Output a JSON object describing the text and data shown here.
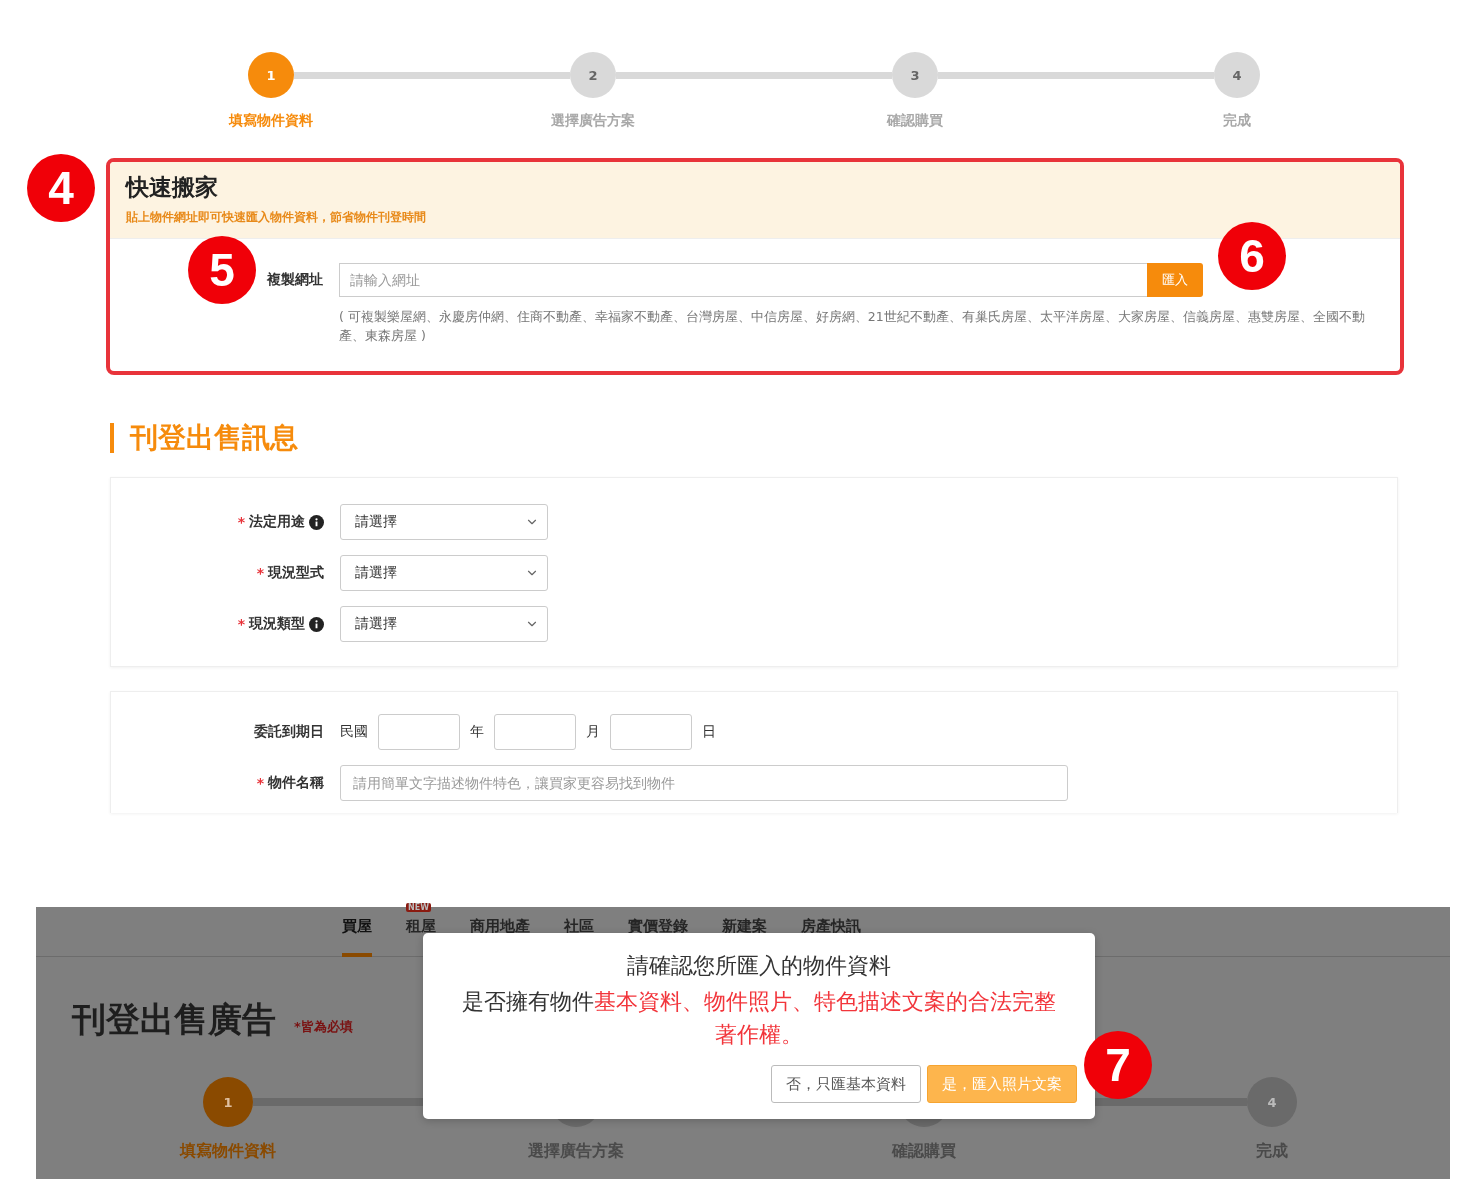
{
  "steps": [
    {
      "number": "1",
      "label": "填寫物件資料",
      "selected": true
    },
    {
      "number": "2",
      "label": "選擇廣告方案",
      "selected": false
    },
    {
      "number": "3",
      "label": "確認購買",
      "selected": false
    },
    {
      "number": "4",
      "label": "完成",
      "selected": false
    }
  ],
  "callouts": [
    "4",
    "5",
    "6",
    "7"
  ],
  "required_mark": "*",
  "quick_import": {
    "title": "快速搬家",
    "subtitle": "貼上物件網址即可快速匯入物件資料，節省物件刊登時間",
    "url_label": "複製網址",
    "url_placeholder": "請輸入網址",
    "import_button": "匯入",
    "supported_sites": "( 可複製樂屋網、永慶房仲網、住商不動產、幸福家不動產、台灣房屋、中信房屋、好房網、21世紀不動產、有巢氏房屋、太平洋房屋、大家房屋、信義房屋、惠雙房屋、全國不動產、東森房屋 )"
  },
  "section_title": "刊登出售訊息",
  "selects": [
    {
      "label": "法定用途",
      "required": true,
      "info": true,
      "value": "請選擇"
    },
    {
      "label": "現況型式",
      "required": true,
      "info": false,
      "value": "請選擇"
    },
    {
      "label": "現況類型",
      "required": true,
      "info": true,
      "value": "請選擇"
    }
  ],
  "expiry": {
    "label": "委託到期日",
    "era": "民國",
    "units": [
      "年",
      "月",
      "日"
    ]
  },
  "title_field": {
    "label": "物件名稱",
    "required": true,
    "placeholder": "請用簡單文字描述物件特色，讓買家更容易找到物件"
  },
  "popup_screen": {
    "nav": [
      {
        "label": "買屋",
        "selected": true
      },
      {
        "label": "租屋",
        "selected": false,
        "badge": "NEW"
      },
      {
        "label": "商用地產",
        "selected": false
      },
      {
        "label": "社區",
        "selected": false
      },
      {
        "label": "實價登錄",
        "selected": false
      },
      {
        "label": "新建案",
        "selected": false
      },
      {
        "label": "房產快訊",
        "selected": false
      }
    ],
    "page_title": "刊登出售廣告",
    "required_note": "*皆為必填",
    "steps": [
      {
        "number": "1",
        "label": "填寫物件資料",
        "selected": true
      },
      {
        "label": "選擇廣告方案",
        "selected": false
      },
      {
        "label": "確認購買",
        "selected": false
      },
      {
        "number": "4",
        "label": "完成",
        "selected": false
      }
    ],
    "dialog": {
      "heading": "請確認您所匯入的物件資料",
      "question_prefix": "是否擁有物件",
      "question_highlight": "基本資料、物件照片、特色描述文案的合法完整著作權。",
      "buttons": [
        {
          "label": "否，只匯基本資料",
          "kind": "secondary"
        },
        {
          "label": "是，匯入照片文案",
          "kind": "primary"
        }
      ]
    }
  }
}
